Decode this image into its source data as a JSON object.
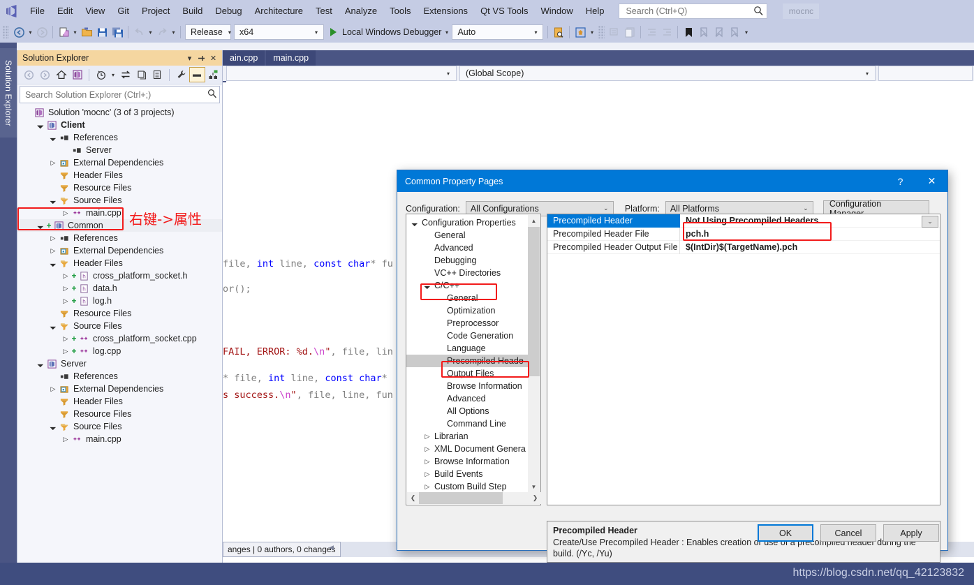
{
  "menubar": {
    "logo_icon": "visual-studio-logo",
    "items": [
      "File",
      "Edit",
      "View",
      "Git",
      "Project",
      "Build",
      "Debug",
      "Architecture",
      "Test",
      "Analyze",
      "Tools",
      "Extensions",
      "Qt VS Tools",
      "Window",
      "Help"
    ],
    "search_placeholder": "Search (Ctrl+Q)",
    "solution_name_tab": "mocnc"
  },
  "toolbar": {
    "back_icon": "navigate-back-icon",
    "forward_icon": "navigate-forward-icon",
    "new_item_icon": "new-item-icon",
    "open_icon": "open-folder-icon",
    "save_icon": "save-icon",
    "save_all_icon": "save-all-icon",
    "undo_icon": "undo-icon",
    "redo_icon": "redo-icon",
    "configuration": "Release",
    "platform": "x64",
    "debug_target": "Local Windows Debugger",
    "debug_mode": "Auto",
    "find_in_files_icon": "find-in-files-icon",
    "home_icon": "home-window-icon",
    "indent_icon": "indent-icon",
    "comment_icon": "comment-icon",
    "outdent_icon": "outdent-icon",
    "bookmark_icon": "bookmark-icon",
    "next_bookmark_icon": "next-bookmark-icon",
    "prev_bookmark_icon": "prev-bookmark-icon",
    "clear_bookmark_icon": "clear-bookmarks-icon"
  },
  "left_dock": {
    "vertical_tab": "Solution Explorer"
  },
  "solution_explorer": {
    "title": "Solution Explorer",
    "dropdown_icon": "chevron-down-icon",
    "pin_icon": "pin-icon",
    "close_icon": "close-icon",
    "toolbar_icons": [
      "back-icon",
      "forward-icon",
      "home-icon",
      "solution-icon",
      "pending-changes-icon",
      "sync-icon",
      "refresh-icon",
      "collapse-all-icon",
      "show-all-files-icon",
      "properties-icon",
      "preview-selected-icon",
      "view-class-diagram-icon"
    ],
    "search_placeholder": "Search Solution Explorer (Ctrl+;)",
    "tree": [
      {
        "indent": 0,
        "expander": "",
        "icon": "solution-icon",
        "label": "Solution 'mocnc' (3 of 3 projects)",
        "bold": false
      },
      {
        "indent": 1,
        "expander": "open",
        "icon": "cpp-project-icon",
        "label": "Client",
        "bold": true
      },
      {
        "indent": 2,
        "expander": "open",
        "icon": "references-icon",
        "label": "References",
        "bold": false
      },
      {
        "indent": 3,
        "expander": "",
        "icon": "references-icon",
        "label": "Server",
        "bold": false
      },
      {
        "indent": 2,
        "expander": "closed",
        "icon": "folder-dep-icon",
        "label": "External Dependencies",
        "bold": false
      },
      {
        "indent": 2,
        "expander": "",
        "icon": "filter-folder-icon",
        "label": "Header Files",
        "bold": false
      },
      {
        "indent": 2,
        "expander": "",
        "icon": "filter-folder-icon",
        "label": "Resource Files",
        "bold": false
      },
      {
        "indent": 2,
        "expander": "open",
        "icon": "filter-folder-open-icon",
        "label": "Source Files",
        "bold": false
      },
      {
        "indent": 3,
        "expander": "closed",
        "icon": "cpp-file-icon",
        "label": "main.cpp",
        "bold": false
      },
      {
        "indent": 1,
        "expander": "open",
        "icon": "cpp-project-icon",
        "label": "Common",
        "bold": false,
        "plus": true,
        "highlight": true
      },
      {
        "indent": 2,
        "expander": "closed",
        "icon": "references-icon",
        "label": "References",
        "bold": false
      },
      {
        "indent": 2,
        "expander": "closed",
        "icon": "folder-dep-icon",
        "label": "External Dependencies",
        "bold": false
      },
      {
        "indent": 2,
        "expander": "open",
        "icon": "filter-folder-open-icon",
        "label": "Header Files",
        "bold": false
      },
      {
        "indent": 3,
        "expander": "closed",
        "icon": "h-file-icon",
        "label": "cross_platform_socket.h",
        "bold": false,
        "plus": true
      },
      {
        "indent": 3,
        "expander": "closed",
        "icon": "h-file-icon",
        "label": "data.h",
        "bold": false,
        "plus": true
      },
      {
        "indent": 3,
        "expander": "closed",
        "icon": "h-file-icon",
        "label": "log.h",
        "bold": false,
        "plus": true
      },
      {
        "indent": 2,
        "expander": "",
        "icon": "filter-folder-icon",
        "label": "Resource Files",
        "bold": false
      },
      {
        "indent": 2,
        "expander": "open",
        "icon": "filter-folder-open-icon",
        "label": "Source Files",
        "bold": false
      },
      {
        "indent": 3,
        "expander": "closed",
        "icon": "cpp-file-icon",
        "label": "cross_platform_socket.cpp",
        "bold": false,
        "plus": true
      },
      {
        "indent": 3,
        "expander": "closed",
        "icon": "cpp-file-icon",
        "label": "log.cpp",
        "bold": false,
        "plus": true
      },
      {
        "indent": 1,
        "expander": "open",
        "icon": "cpp-project-icon",
        "label": "Server",
        "bold": false
      },
      {
        "indent": 2,
        "expander": "",
        "icon": "references-icon",
        "label": "References",
        "bold": false
      },
      {
        "indent": 2,
        "expander": "closed",
        "icon": "folder-dep-icon",
        "label": "External Dependencies",
        "bold": false
      },
      {
        "indent": 2,
        "expander": "",
        "icon": "filter-folder-icon",
        "label": "Header Files",
        "bold": false
      },
      {
        "indent": 2,
        "expander": "",
        "icon": "filter-folder-icon",
        "label": "Resource Files",
        "bold": false
      },
      {
        "indent": 2,
        "expander": "open",
        "icon": "filter-folder-open-icon",
        "label": "Source Files",
        "bold": false
      },
      {
        "indent": 3,
        "expander": "closed",
        "icon": "cpp-file-icon",
        "label": "main.cpp",
        "bold": false
      }
    ]
  },
  "annotations": {
    "color": "#f21b1b",
    "common_note": "右键->属性"
  },
  "editor": {
    "tabs": [
      "ain.cpp",
      "main.cpp"
    ],
    "scope_combo_left": "",
    "scope_combo_right": "(Global Scope)",
    "code_lines": [
      "file, int line, const char* fu",
      "or();",
      "FAIL, ERROR: %d.\\n\", file, lin",
      "* file, int line, const char*",
      "s success.\\n\", file, line, fun"
    ],
    "git_status": "anges | 0 authors, 0 changes"
  },
  "dialog": {
    "title": "Common Property Pages",
    "help_icon": "help-question-icon",
    "close_icon": "close-icon",
    "configuration_label": "Configuration:",
    "configuration_value": "All Configurations",
    "platform_label": "Platform:",
    "platform_value": "All Platforms",
    "configuration_manager_button": "Configuration Manager...",
    "tree": [
      {
        "indent": 0,
        "expander": "open",
        "label": "Configuration Properties"
      },
      {
        "indent": 1,
        "expander": "",
        "label": "General"
      },
      {
        "indent": 1,
        "expander": "",
        "label": "Advanced"
      },
      {
        "indent": 1,
        "expander": "",
        "label": "Debugging"
      },
      {
        "indent": 1,
        "expander": "",
        "label": "VC++ Directories"
      },
      {
        "indent": 1,
        "expander": "open",
        "label": "C/C++",
        "boxed": true
      },
      {
        "indent": 2,
        "expander": "",
        "label": "General"
      },
      {
        "indent": 2,
        "expander": "",
        "label": "Optimization"
      },
      {
        "indent": 2,
        "expander": "",
        "label": "Preprocessor"
      },
      {
        "indent": 2,
        "expander": "",
        "label": "Code Generation"
      },
      {
        "indent": 2,
        "expander": "",
        "label": "Language"
      },
      {
        "indent": 2,
        "expander": "",
        "label": "Precompiled Heade",
        "selected": true,
        "boxed": true
      },
      {
        "indent": 2,
        "expander": "",
        "label": "Output Files"
      },
      {
        "indent": 2,
        "expander": "",
        "label": "Browse Information"
      },
      {
        "indent": 2,
        "expander": "",
        "label": "Advanced"
      },
      {
        "indent": 2,
        "expander": "",
        "label": "All Options"
      },
      {
        "indent": 2,
        "expander": "",
        "label": "Command Line"
      },
      {
        "indent": 1,
        "expander": "closed",
        "label": "Librarian"
      },
      {
        "indent": 1,
        "expander": "closed",
        "label": "XML Document Genera"
      },
      {
        "indent": 1,
        "expander": "closed",
        "label": "Browse Information"
      },
      {
        "indent": 1,
        "expander": "closed",
        "label": "Build Events"
      },
      {
        "indent": 1,
        "expander": "closed",
        "label": "Custom Build Step"
      }
    ],
    "properties": [
      {
        "name": "Precompiled Header",
        "value": "Not Using Precompiled Headers",
        "selected": true,
        "boxed": true
      },
      {
        "name": "Precompiled Header File",
        "value": "pch.h"
      },
      {
        "name": "Precompiled Header Output File",
        "value": "$(IntDir)$(TargetName).pch"
      }
    ],
    "description": {
      "title": "Precompiled Header",
      "body": "Create/Use Precompiled Header : Enables creation or use of a precompiled header during the build. (/Yc, /Yu)"
    },
    "buttons": {
      "ok": "OK",
      "cancel": "Cancel",
      "apply": "Apply"
    }
  },
  "watermark": "https://blog.csdn.net/qq_42123832",
  "colors": {
    "chrome": "#c5cce4",
    "accent_blue": "#0078d7",
    "annotation_red": "#f21b1b",
    "solexp_title": "#f5d6a0",
    "dock_blue": "#4a5584"
  }
}
